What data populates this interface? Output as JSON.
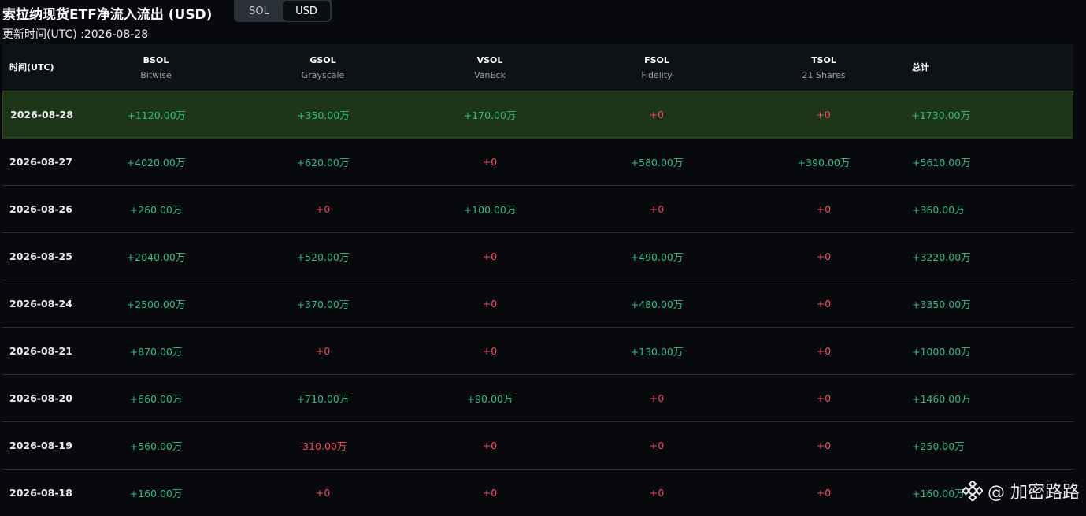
{
  "header": {
    "title": "索拉纳现货ETF净流入流出 (USD)",
    "updated": "更新时间(UTC) :2026-08-28",
    "toggle": [
      {
        "label": "SOL",
        "active": false
      },
      {
        "label": "USD",
        "active": true
      }
    ]
  },
  "table": {
    "columns": [
      {
        "ticker": "时间(UTC)",
        "issuer": ""
      },
      {
        "ticker": "BSOL",
        "issuer": "Bitwise"
      },
      {
        "ticker": "GSOL",
        "issuer": "Grayscale"
      },
      {
        "ticker": "VSOL",
        "issuer": "VanEck"
      },
      {
        "ticker": "FSOL",
        "issuer": "Fidelity"
      },
      {
        "ticker": "TSOL",
        "issuer": "21 Shares"
      },
      {
        "ticker": "总计",
        "issuer": ""
      }
    ],
    "rows": [
      {
        "date": "2026-08-28",
        "values": [
          "+1120.00万",
          "+350.00万",
          "+170.00万",
          "+0",
          "+0",
          "+1730.00万"
        ],
        "highlight": true
      },
      {
        "date": "2026-08-27",
        "values": [
          "+4020.00万",
          "+620.00万",
          "+0",
          "+580.00万",
          "+390.00万",
          "+5610.00万"
        ]
      },
      {
        "date": "2026-08-26",
        "values": [
          "+260.00万",
          "+0",
          "+100.00万",
          "+0",
          "+0",
          "+360.00万"
        ]
      },
      {
        "date": "2026-08-25",
        "values": [
          "+2040.00万",
          "+520.00万",
          "+0",
          "+490.00万",
          "+0",
          "+3220.00万"
        ]
      },
      {
        "date": "2026-08-24",
        "values": [
          "+2500.00万",
          "+370.00万",
          "+0",
          "+480.00万",
          "+0",
          "+3350.00万"
        ]
      },
      {
        "date": "2026-08-21",
        "values": [
          "+870.00万",
          "+0",
          "+0",
          "+130.00万",
          "+0",
          "+1000.00万"
        ]
      },
      {
        "date": "2026-08-20",
        "values": [
          "+660.00万",
          "+710.00万",
          "+90.00万",
          "+0",
          "+0",
          "+1460.00万"
        ]
      },
      {
        "date": "2026-08-19",
        "values": [
          "+560.00万",
          "-310.00万",
          "+0",
          "+0",
          "+0",
          "+250.00万"
        ]
      },
      {
        "date": "2026-08-18",
        "values": [
          "+160.00万",
          "+0",
          "+0",
          "+0",
          "+0",
          "+160.00万"
        ]
      }
    ]
  },
  "watermark": {
    "icon": "binance-logo-icon",
    "text": "@ 加密路路"
  },
  "colors": {
    "positive": "#2ebd85",
    "negative": "#f6465d",
    "highlight_row": "#1d3617",
    "background": "#07090d"
  }
}
